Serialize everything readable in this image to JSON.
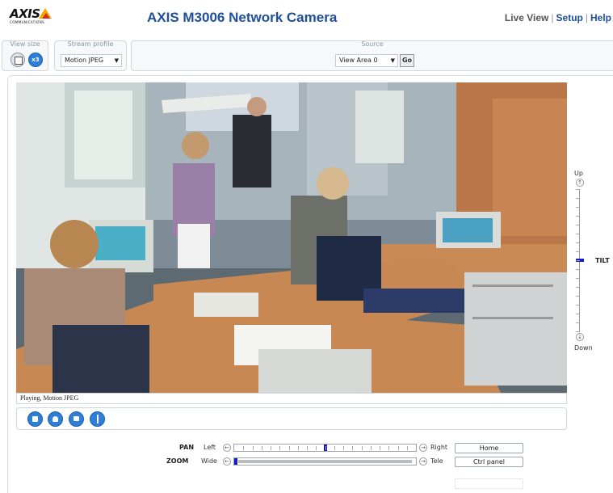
{
  "header": {
    "logo_text": "AXIS",
    "logo_subtext": "COMMUNICATIONS",
    "title": "AXIS M3006 Network Camera",
    "nav": [
      {
        "label": "Live View"
      },
      {
        "label": "Setup"
      },
      {
        "label": "Help"
      }
    ],
    "accent_color": "#1f4f9a"
  },
  "toolbar": {
    "view_size": {
      "label": "View size",
      "buttons": [
        {
          "icon": "single-view-icon"
        },
        {
          "icon": "x3-view-icon",
          "text": "x3"
        }
      ]
    },
    "stream_profile": {
      "label": "Stream profile",
      "selected": "Motion JPEG"
    },
    "source": {
      "label": "Source",
      "selected": "View Area 0",
      "go_label": "Go"
    }
  },
  "video": {
    "status": "Playing, Motion JPEG",
    "controls": [
      {
        "icon": "stop-icon"
      },
      {
        "icon": "snapshot-icon"
      },
      {
        "icon": "view-full-screen-icon"
      },
      {
        "icon": "audio-icon"
      }
    ]
  },
  "tilt": {
    "up_label": "Up",
    "down_label": "Down",
    "name": "TILT",
    "position": 0.5
  },
  "pan": {
    "name": "PAN",
    "left_label": "Left",
    "right_label": "Right",
    "position": 0.5
  },
  "zoom": {
    "name": "ZOOM",
    "wide_label": "Wide",
    "tele_label": "Tele",
    "position": 0.0
  },
  "side_buttons": {
    "home_label": "Home",
    "ctrl_panel_label": "Ctrl panel"
  }
}
